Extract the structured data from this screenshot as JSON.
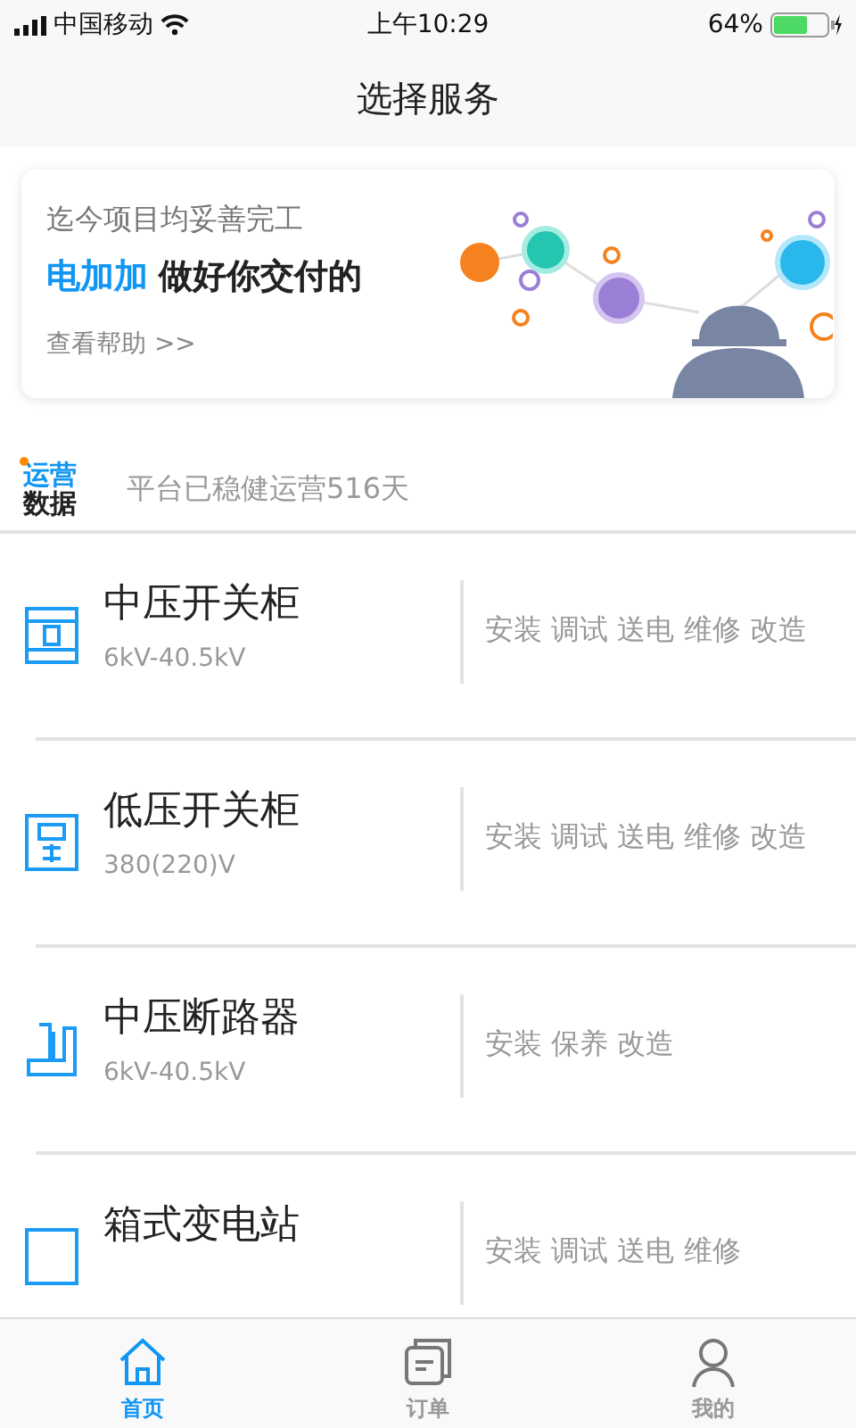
{
  "status_bar": {
    "carrier": "中国移动",
    "time": "上午10:29",
    "battery": "64%"
  },
  "header": {
    "title": "选择服务"
  },
  "banner": {
    "line1": "迄今项目均妥善完工",
    "brand": "电加加",
    "slogan": "做好你交付的",
    "link": "查看帮助 >>"
  },
  "stats": {
    "logo_top": "运营",
    "logo_bottom": "数据",
    "text": "平台已稳健运营516天"
  },
  "services": [
    {
      "kind": "medium-cabinet",
      "title": "中压开关柜",
      "spec": "6kV-40.5kV",
      "tasks": "安装 调试 送电 维修 改造"
    },
    {
      "kind": "low-cabinet",
      "title": "低压开关柜",
      "spec": "380(220)V",
      "tasks": "安装 调试 送电 维修 改造"
    },
    {
      "kind": "breaker",
      "title": "中压断路器",
      "spec": "6kV-40.5kV",
      "tasks": "安装 保养 改造"
    },
    {
      "kind": "substation",
      "title": "箱式变电站",
      "tasks": "安装 调试 送电 维修"
    }
  ],
  "tabs": [
    {
      "kind": "home",
      "label": "首页",
      "selected": true
    },
    {
      "kind": "orders",
      "label": "订单",
      "selected": false
    },
    {
      "kind": "profile",
      "label": "我的",
      "selected": false
    }
  ]
}
